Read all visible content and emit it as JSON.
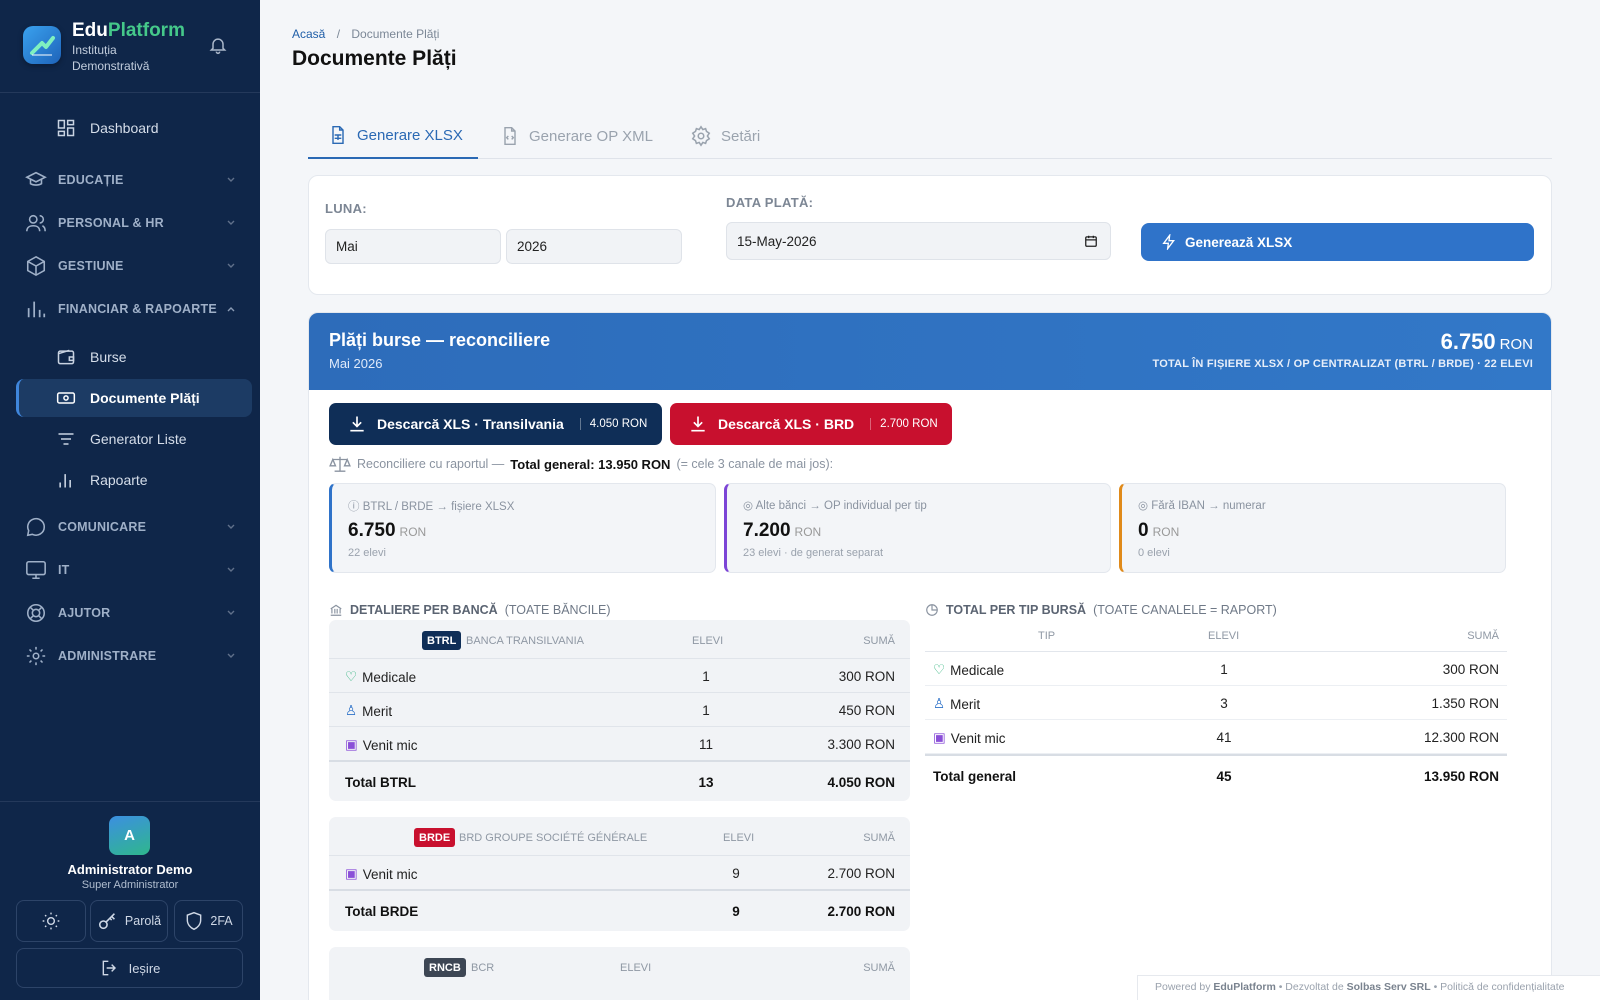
{
  "brand": {
    "name_main": "Edu",
    "name_accent": "Platform",
    "institution": "Instituția Demonstrativă"
  },
  "nav": {
    "dashboard": "Dashboard",
    "educatie": "EDUCAȚIE",
    "personal": "PERSONAL & HR",
    "gestiune": "GESTIUNE",
    "financiar": "FINANCIAR & RAPOARTE",
    "burse": "Burse",
    "documente": "Documente Plăți",
    "generator": "Generator Liste",
    "rapoarte": "Rapoarte",
    "comunicare": "COMUNICARE",
    "it": "IT",
    "ajutor": "AJUTOR",
    "administrare": "ADMINISTRARE"
  },
  "user": {
    "initial": "A",
    "name": "Administrator Demo",
    "role": "Super Administrator",
    "password": "Parolă",
    "twofa": "2FA",
    "logout": "Ieșire"
  },
  "breadcrumb": {
    "home": "Acasă",
    "sep": "/",
    "current": "Documente Plăți"
  },
  "page_title": "Documente Plăți",
  "tabs": {
    "xlsx": "Generare XLSX",
    "op": "Generare OP XML",
    "settings": "Setări"
  },
  "filters": {
    "luna_label": "LUNA:",
    "month": "Mai",
    "year": "2026",
    "data_label": "DATA PLATĂ:",
    "date": "15-May-2026",
    "generate": "Generează XLSX"
  },
  "banner": {
    "title": "Plăți burse — reconciliere",
    "subtitle": "Mai 2026",
    "amount": "6.750",
    "unit": "RON",
    "note": "TOTAL ÎN FIȘIERE XLSX / OP CENTRALIZAT (BTRL / BRDE) · 22 ELEVI"
  },
  "downloads": {
    "btrl_label": "Descarcă XLS · Transilvania",
    "btrl_amount": "4.050 RON",
    "brd_label": "Descarcă XLS · BRD",
    "brd_amount": "2.700 RON"
  },
  "recon": {
    "prefix": "Reconciliere cu raportul —",
    "total": "Total general: 13.950 RON",
    "suffix": "(= cele 3 canale de mai jos):"
  },
  "channels": [
    {
      "label": "BTRL / BRDE → fișiere XLSX",
      "value": "6.750",
      "unit": "RON",
      "sub": "22 elevi",
      "color": "#2f73c9"
    },
    {
      "label": "Alte bănci → OP individual per tip",
      "value": "7.200",
      "unit": "RON",
      "sub": "23 elevi · de generat separat",
      "color": "#7c45d6"
    },
    {
      "label": "Fără IBAN → numerar",
      "value": "0",
      "unit": "RON",
      "sub": "0 elevi",
      "color": "#e08a1a"
    }
  ],
  "bank_section": {
    "title": "DETALIERE PER BANCĂ",
    "qualifier": "(TOATE BĂNCILE)"
  },
  "col": {
    "elevi": "ELEVI",
    "suma": "SUMĂ",
    "tip": "TIP"
  },
  "banks": {
    "btrl": {
      "tag": "BTRL",
      "name": "BANCA TRANSILVANIA",
      "color": "#0f2e57",
      "rows": [
        {
          "name": "Medicale",
          "elevi": "1",
          "suma": "300 RON"
        },
        {
          "name": "Merit",
          "elevi": "1",
          "suma": "450 RON"
        },
        {
          "name": "Venit mic",
          "elevi": "11",
          "suma": "3.300 RON"
        }
      ],
      "total": {
        "name": "Total BTRL",
        "elevi": "13",
        "suma": "4.050 RON"
      }
    },
    "brde": {
      "tag": "BRDE",
      "name": "BRD GROUPE SOCIÉTÉ GÉNÉRALE",
      "color": "#c8102e",
      "rows": [
        {
          "name": "Venit mic",
          "elevi": "9",
          "suma": "2.700 RON"
        }
      ],
      "total": {
        "name": "Total BRDE",
        "elevi": "9",
        "suma": "2.700 RON"
      }
    },
    "rncb": {
      "tag": "RNCB",
      "name": "BCR",
      "color": "#3d4654"
    }
  },
  "type_section": {
    "title": "TOTAL PER TIP BURSĂ",
    "qualifier": "(TOATE CANALELE = RAPORT)"
  },
  "type_rows": [
    {
      "name": "Medicale",
      "elevi": "1",
      "suma": "300 RON"
    },
    {
      "name": "Merit",
      "elevi": "3",
      "suma": "1.350 RON"
    },
    {
      "name": "Venit mic",
      "elevi": "41",
      "suma": "12.300 RON"
    }
  ],
  "type_total": {
    "name": "Total general",
    "elevi": "45",
    "suma": "13.950 RON"
  },
  "footer": {
    "powered": "Powered by",
    "brand": "EduPlatform",
    "dev": "• Dezvoltat de",
    "company": "Solbas Serv SRL",
    "policy": "• Politică de confidențialitate"
  },
  "colors": {
    "sidebar": "#0f2649",
    "primary": "#2f73c9",
    "btrl": "#0f2e57",
    "brd": "#c8102e",
    "active": "#1c3b64"
  }
}
